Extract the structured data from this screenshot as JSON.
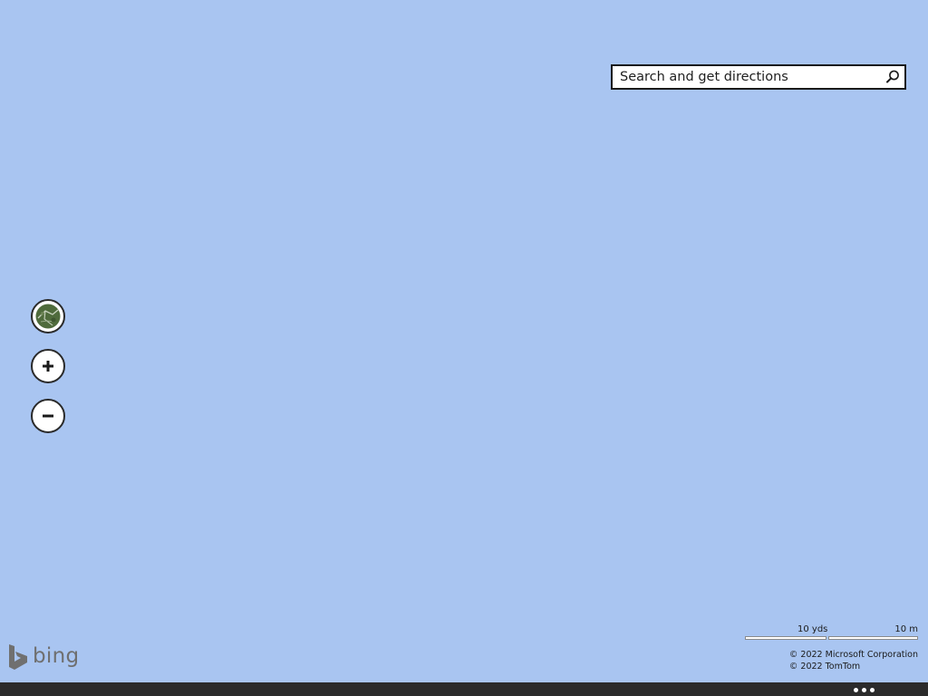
{
  "search": {
    "placeholder": "Search and get directions",
    "button_icon": "search-icon"
  },
  "controls": {
    "map_style_icon": "aerial-view-icon",
    "zoom_in_icon": "plus-icon",
    "zoom_out_icon": "minus-icon"
  },
  "branding": {
    "logo_text": "bing"
  },
  "scale": {
    "imperial": "10 yds",
    "metric": "10 m"
  },
  "copyright": {
    "line1": "© 2022 Microsoft Corporation",
    "line2": "© 2022 TomTom"
  },
  "bottom_bar": {
    "more_icon": "more-dots-icon"
  },
  "colors": {
    "water": "#a9c5f1",
    "bottom_bar": "#2b2b2b"
  }
}
